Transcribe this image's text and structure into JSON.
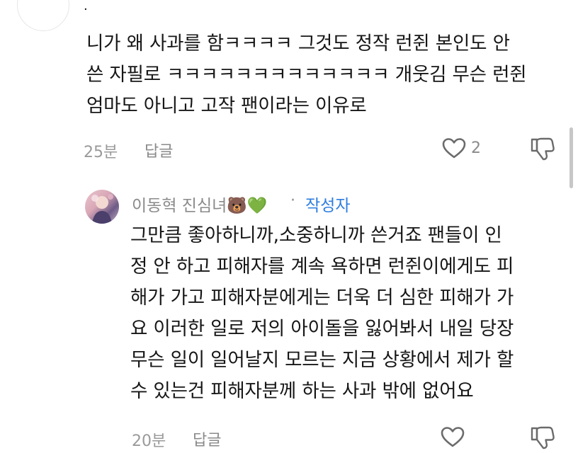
{
  "comment": {
    "author": "·",
    "lines": [
      "니가 왜 사과를 함ㅋㅋㅋㅋ 그것도 정작 런쥔 본인도 안",
      "쓴 자필로 ㅋㅋㅋㅋㅋㅋㅋㅋㅋㅋㅋㅋㅋ 개웃김 무슨 런쥔",
      "엄마도 아니고 고작 팬이라는 이유로"
    ],
    "time": "25분",
    "reply_label": "답글",
    "like_count": "2"
  },
  "reply": {
    "author": "이동혁 진심녀",
    "author_emojis": "🐻💚",
    "separator": "·",
    "author_badge": "작성자",
    "lines": [
      "그만큼 좋아하니까,소중하니까 쓴거죠 팬들이 인",
      "정 안 하고 피해자를 계속 욕하면 런쥔이에게도 피",
      "해가 가고 피해자분에게는 더욱 더 심한 피해가 가",
      "요 이러한 일로 저의 아이돌을 잃어봐서 내일 당장",
      "무슨 일이 일어날지 모르는 지금 상황에서 제가 할",
      "수 있는건 피해자분께 하는 사과 밖에 없어요"
    ],
    "time": "20분",
    "reply_label": "답글"
  },
  "icons": {
    "like": "heart-outline-icon",
    "dislike": "thumbs-down-outline-icon"
  },
  "colors": {
    "text": "#161616",
    "meta": "#9a9a9a",
    "badge": "#2e7de0"
  }
}
